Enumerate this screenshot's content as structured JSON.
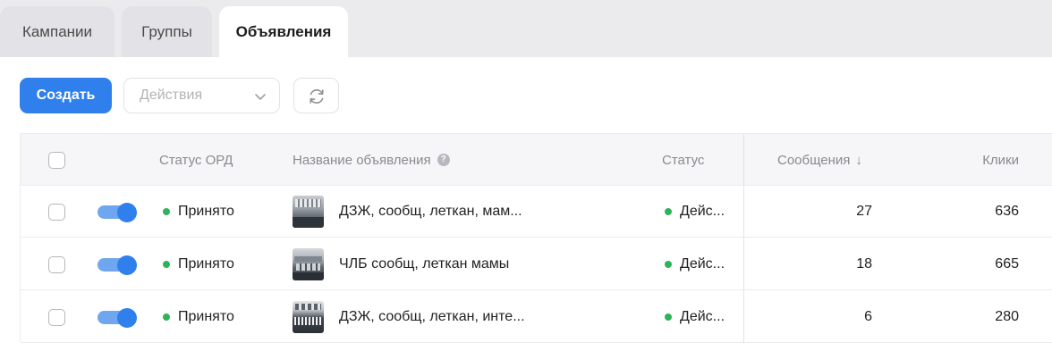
{
  "tabs": [
    {
      "label": "Кампании",
      "active": false
    },
    {
      "label": "Группы",
      "active": false
    },
    {
      "label": "Объявления",
      "active": true
    }
  ],
  "toolbar": {
    "create_label": "Создать",
    "actions_placeholder": "Действия",
    "refresh_icon": "refresh-icon"
  },
  "table": {
    "columns": {
      "ord_status": "Статус ОРД",
      "ad_name": "Название объявления",
      "status": "Статус",
      "messages": "Сообщения",
      "messages_sort": "↓",
      "clicks": "Клики"
    },
    "rows": [
      {
        "ord_status": "Принято",
        "name": "ДЗЖ, сообщ, леткан, мам...",
        "status": "Дейс...",
        "messages": "27",
        "clicks": "636",
        "enabled": true
      },
      {
        "ord_status": "Принято",
        "name": "ЧЛБ сообщ, леткан мамы",
        "status": "Дейс...",
        "messages": "18",
        "clicks": "665",
        "enabled": true
      },
      {
        "ord_status": "Принято",
        "name": "ДЗЖ, сообщ, леткан, инте...",
        "status": "Дейс...",
        "messages": "6",
        "clicks": "280",
        "enabled": true
      }
    ]
  },
  "colors": {
    "accent": "#2f80ed",
    "status_ok": "#2fb35a"
  }
}
